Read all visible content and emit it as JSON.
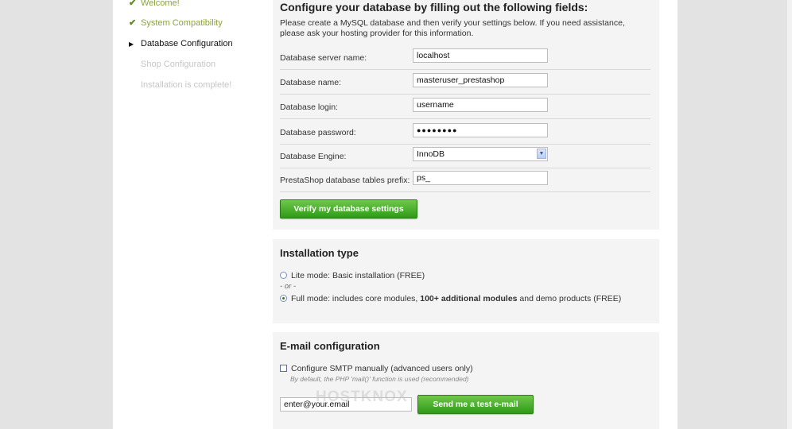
{
  "steps": [
    {
      "label": "Welcome!",
      "state": "done"
    },
    {
      "label": "System Compatibility",
      "state": "done"
    },
    {
      "label": "Database Configuration",
      "state": "current"
    },
    {
      "label": "Shop Configuration",
      "state": "todo"
    },
    {
      "label": "Installation is complete!",
      "state": "todo"
    }
  ],
  "database": {
    "heading": "Configure your database by filling out the following fields:",
    "intro": "Please create a MySQL database and then verify your settings below. If you need assistance, please ask your hosting provider for this information.",
    "fields": [
      {
        "label": "Database server name:",
        "value": "localhost"
      },
      {
        "label": "Database name:",
        "value": "masteruser_prestashop"
      },
      {
        "label": "Database login:",
        "value": "username"
      },
      {
        "label": "Database password:",
        "value": "●●●●●●●●"
      },
      {
        "label": "Database Engine:",
        "value": "InnoDB"
      },
      {
        "label": "PrestaShop database tables prefix:",
        "value": "ps_"
      }
    ],
    "verify_button": "Verify my database settings"
  },
  "install_type": {
    "heading": "Installation type",
    "lite_label": "Lite mode: Basic installation (FREE)",
    "or_text": "- or -",
    "full_label_pre": "Full mode: includes core modules, ",
    "full_label_bold": "100+ additional modules",
    "full_label_post": " and demo products (FREE)",
    "selected": "full"
  },
  "email": {
    "heading": "E-mail configuration",
    "smtp_label": "Configure SMTP manually (advanced users only)",
    "smtp_hint": "By default, the PHP 'mail()' function is used (recommended)",
    "email_value": "enter@your.email",
    "test_button": "Send me a test e-mail"
  },
  "watermark": "HOSTKNOX",
  "colors": {
    "accent_green": "#2f9a18",
    "done_green": "#8aa33c"
  }
}
